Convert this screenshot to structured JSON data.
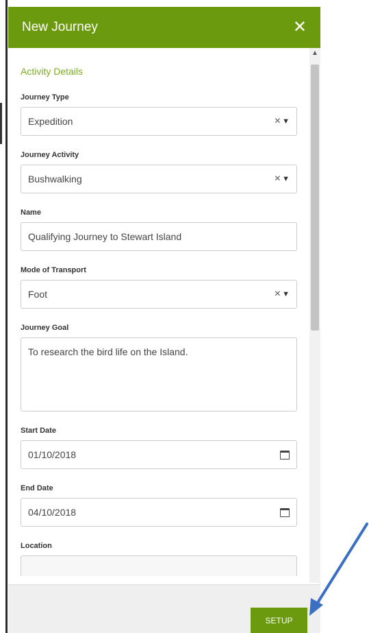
{
  "dialog": {
    "title": "New Journey",
    "close_glyph": "✕"
  },
  "section_title": "Activity Details",
  "fields": {
    "journey_type": {
      "label": "Journey Type",
      "value": "Expedition"
    },
    "journey_activity": {
      "label": "Journey Activity",
      "value": "Bushwalking"
    },
    "name": {
      "label": "Name",
      "value": "Qualifying Journey to Stewart Island"
    },
    "mode_of_transport": {
      "label": "Mode of Transport",
      "value": "Foot"
    },
    "journey_goal": {
      "label": "Journey Goal",
      "value": "To research the bird life on the Island."
    },
    "start_date": {
      "label": "Start Date",
      "value": "01/10/2018"
    },
    "end_date": {
      "label": "End Date",
      "value": "04/10/2018"
    },
    "location": {
      "label": "Location"
    }
  },
  "glyphs": {
    "clear": "×",
    "caret": "▼",
    "scroll_up": "▲"
  },
  "footer": {
    "setup_label": "SETUP"
  },
  "colors": {
    "brand_green": "#6b9a0e",
    "section_green": "#7cae1d",
    "arrow_blue": "#3a6fc4"
  }
}
